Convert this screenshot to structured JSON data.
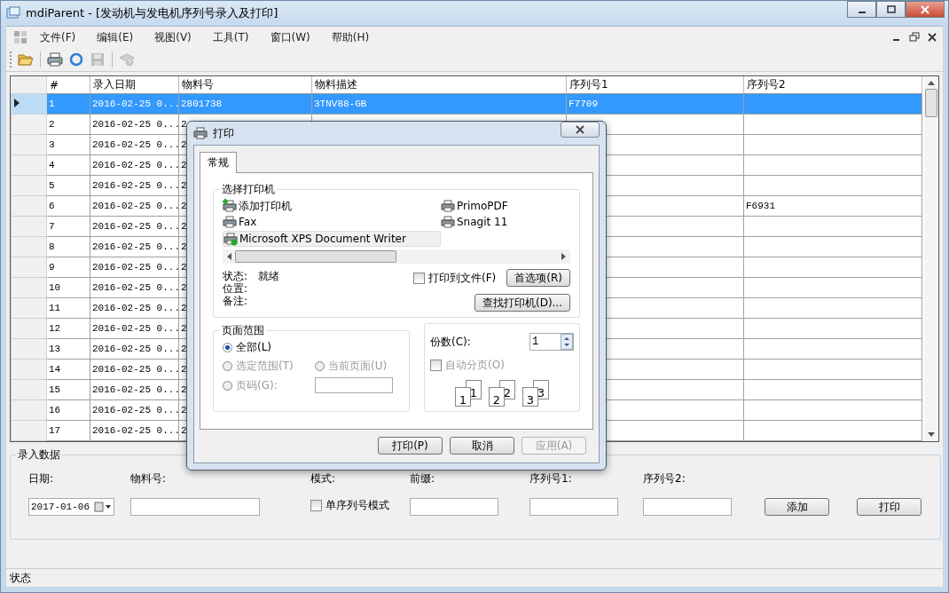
{
  "window": {
    "title": "mdiParent - [发动机与发电机序列号录入及打印]"
  },
  "menu": [
    "文件(F)",
    "编辑(E)",
    "视图(V)",
    "工具(T)",
    "窗口(W)",
    "帮助(H)"
  ],
  "toolbar": [
    {
      "kind": "open",
      "disabled": false
    },
    {
      "kind": "print",
      "disabled": false
    },
    {
      "kind": "refresh",
      "disabled": false
    },
    {
      "kind": "save",
      "disabled": true
    },
    {
      "kind": "help",
      "disabled": true
    }
  ],
  "grid": {
    "columns": [
      "#",
      "录入日期",
      "物料号",
      "物料描述",
      "序列号1",
      "序列号2"
    ],
    "rows": [
      {
        "selected": true,
        "no": "1",
        "date": "2016-02-25 0...",
        "material": "2801738",
        "description": "3TNV88-GB",
        "serial1": "F7709"
      },
      {
        "selected": false,
        "no": "2",
        "date": "2016-02-25 0...",
        "material": "2"
      },
      {
        "selected": false,
        "no": "3",
        "date": "2016-02-25 0...",
        "material": "2"
      },
      {
        "selected": false,
        "no": "4",
        "date": "2016-02-25 0...",
        "material": "2"
      },
      {
        "selected": false,
        "no": "5",
        "date": "2016-02-25 0...",
        "material": "2"
      },
      {
        "selected": false,
        "no": "6",
        "date": "2016-02-25 0...",
        "material": "2",
        "serial2": "F6931"
      },
      {
        "selected": false,
        "no": "7",
        "date": "2016-02-25 0...",
        "material": "2"
      },
      {
        "selected": false,
        "no": "8",
        "date": "2016-02-25 0...",
        "material": "2"
      },
      {
        "selected": false,
        "no": "9",
        "date": "2016-02-25 0...",
        "material": "2"
      },
      {
        "selected": false,
        "no": "10",
        "date": "2016-02-25 0...",
        "material": "2"
      },
      {
        "selected": false,
        "no": "11",
        "date": "2016-02-25 0...",
        "material": "2"
      },
      {
        "selected": false,
        "no": "12",
        "date": "2016-02-25 0...",
        "material": "2"
      },
      {
        "selected": false,
        "no": "13",
        "date": "2016-02-25 0...",
        "material": "2"
      },
      {
        "selected": false,
        "no": "14",
        "date": "2016-02-25 0...",
        "material": "2"
      },
      {
        "selected": false,
        "no": "15",
        "date": "2016-02-25 0...",
        "material": "2"
      },
      {
        "selected": false,
        "no": "16",
        "date": "2016-02-25 0...",
        "material": "2"
      },
      {
        "selected": false,
        "no": "17",
        "date": "2016-02-25 0...",
        "material": "2"
      }
    ]
  },
  "dialog": {
    "title": "打印",
    "tabs": [
      {
        "label": "常规",
        "selected": true
      }
    ],
    "printer_group": "选择打印机",
    "printers": [
      {
        "name": "添加打印机",
        "kind": "add",
        "default": false,
        "selected": false
      },
      {
        "name": "PrimoPDF",
        "kind": "printer",
        "default": false,
        "selected": false
      },
      {
        "name": "Fax",
        "kind": "printer",
        "default": false,
        "selected": false
      },
      {
        "name": "Snagit 11",
        "kind": "printer",
        "default": false,
        "selected": false
      },
      {
        "name": "Microsoft XPS Document Writer",
        "kind": "printer",
        "default": true,
        "selected": true
      }
    ],
    "status_label": "状态:",
    "status_value": "就绪",
    "location_label": "位置:",
    "comment_label": "备注:",
    "print_to_file": {
      "label": "打印到文件(F)",
      "checked": false
    },
    "preferences_button": "首选项(R)",
    "find_button": "查找打印机(D)...",
    "page_range": {
      "title": "页面范围",
      "options": [
        {
          "label": "全部(L)",
          "selected": true,
          "disabled": false
        },
        {
          "label": "选定范围(T)",
          "selected": false,
          "disabled": true
        },
        {
          "label": "当前页面(U)",
          "selected": false,
          "disabled": true
        },
        {
          "label": "页码(G):",
          "selected": false,
          "disabled": true
        }
      ]
    },
    "copies": {
      "label": "份数(C):",
      "value": "1"
    },
    "collate": {
      "label": "自动分页(O)",
      "checked": false,
      "disabled": true
    },
    "collate_pages": [
      {
        "back": "1",
        "front": "1"
      },
      {
        "back": "2",
        "front": "2"
      },
      {
        "back": "3",
        "front": "3"
      }
    ],
    "buttons": [
      {
        "label": "打印(P)",
        "disabled": false
      },
      {
        "label": "取消",
        "disabled": false
      },
      {
        "label": "应用(A)",
        "disabled": true
      }
    ]
  },
  "entry": {
    "title": "录入数据",
    "fields": [
      {
        "kind": "date",
        "label": "日期:",
        "value": "2017-01-06"
      },
      {
        "kind": "text",
        "label": "物料号:"
      },
      {
        "kind": "checkbox",
        "label": "模式:",
        "option": "单序列号模式",
        "checked": false
      },
      {
        "kind": "text",
        "label": "前缀:"
      },
      {
        "kind": "text",
        "label": "序列号1:"
      },
      {
        "kind": "text",
        "label": "序列号2:"
      }
    ],
    "buttons": [
      "添加",
      "打印"
    ]
  },
  "status_bar": "状态"
}
